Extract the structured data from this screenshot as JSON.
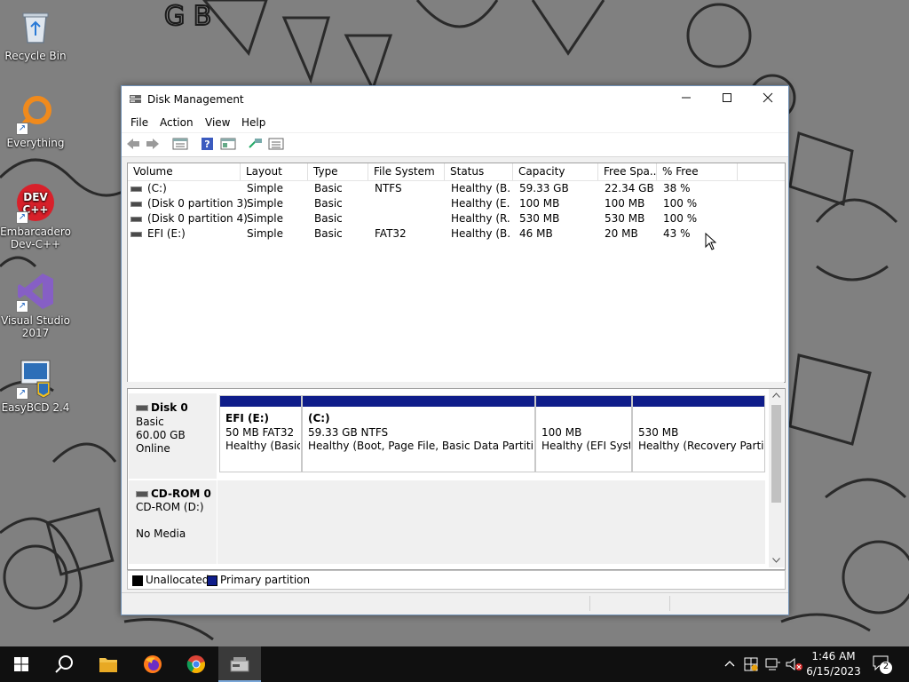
{
  "desktop": {
    "icons": [
      {
        "label": "Recycle Bin"
      },
      {
        "label": "Everything"
      },
      {
        "label": "Embarcadero\nDev-C++",
        "line1": "Embarcadero",
        "line2": "Dev-C++"
      },
      {
        "label": "Visual Studio 2017",
        "line1": "Visual Studio",
        "line2": "2017"
      },
      {
        "label": "EasyBCD 2.4"
      }
    ]
  },
  "window": {
    "title": "Disk Management",
    "menu": [
      "File",
      "Action",
      "View",
      "Help"
    ],
    "columns": [
      "Volume",
      "Layout",
      "Type",
      "File System",
      "Status",
      "Capacity",
      "Free Spa...",
      "% Free"
    ],
    "volumes": [
      {
        "volume": "(C:)",
        "layout": "Simple",
        "type": "Basic",
        "fs": "NTFS",
        "status": "Healthy (B...",
        "capacity": "59.33 GB",
        "free": "22.34 GB",
        "pct": "38 %"
      },
      {
        "volume": "(Disk 0 partition 3)",
        "layout": "Simple",
        "type": "Basic",
        "fs": "",
        "status": "Healthy (E...",
        "capacity": "100 MB",
        "free": "100 MB",
        "pct": "100 %"
      },
      {
        "volume": "(Disk 0 partition 4)",
        "layout": "Simple",
        "type": "Basic",
        "fs": "",
        "status": "Healthy (R...",
        "capacity": "530 MB",
        "free": "530 MB",
        "pct": "100 %"
      },
      {
        "volume": "EFI (E:)",
        "layout": "Simple",
        "type": "Basic",
        "fs": "FAT32",
        "status": "Healthy (B...",
        "capacity": "46 MB",
        "free": "20 MB",
        "pct": "43 %"
      }
    ],
    "disks": {
      "disk0": {
        "name": "Disk 0",
        "type": "Basic",
        "size": "60.00 GB",
        "state": "Online",
        "partitions": [
          {
            "name": "EFI  (E:)",
            "size": "50 MB FAT32",
            "status": "Healthy (Basic"
          },
          {
            "name": "(C:)",
            "size": "59.33 GB NTFS",
            "status": "Healthy (Boot, Page File, Basic Data Partition)"
          },
          {
            "name": "",
            "size": "100 MB",
            "status": "Healthy (EFI Syste"
          },
          {
            "name": "",
            "size": "530 MB",
            "status": "Healthy (Recovery Partitic"
          }
        ]
      },
      "cdrom0": {
        "name": "CD-ROM 0",
        "drive": "CD-ROM (D:)",
        "media": "No Media"
      }
    },
    "legend": {
      "unallocated": "Unallocated",
      "primary": "Primary partition"
    },
    "colors": {
      "primary_partition_bar": "#0f1d8a",
      "unallocated": "#000000"
    }
  },
  "taskbar": {
    "time": "1:46 AM",
    "date": "6/15/2023",
    "notification_count": "2",
    "apps": [
      "start-icon",
      "search-icon",
      "file-explorer-icon",
      "firefox-icon",
      "chrome-icon",
      "disk-management-icon"
    ]
  }
}
